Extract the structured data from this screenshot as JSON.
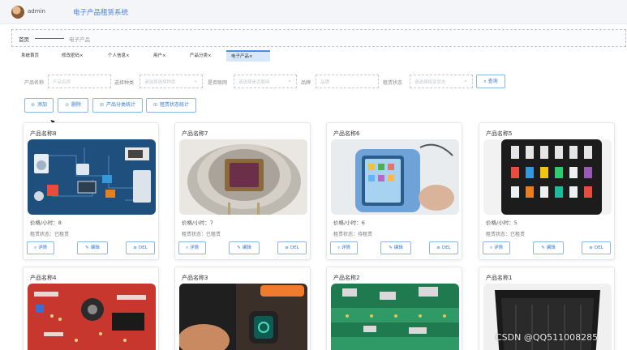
{
  "header": {
    "user": "admin",
    "system_title": "电子产品租赁系统",
    "avatar_icon": "user-avatar"
  },
  "breadcrumb": {
    "home": "首页",
    "current": "电子产品"
  },
  "tabs": [
    {
      "label": "系统首页"
    },
    {
      "label": "修改密码×"
    },
    {
      "label": "个人信息×"
    },
    {
      "label": "用户×"
    },
    {
      "label": "产品分类×"
    },
    {
      "label": "电子产品×",
      "active": true
    }
  ],
  "filters": {
    "name_label": "产品名称",
    "name_placeholder": "产品名称",
    "category_label": "选择种类",
    "category_placeholder": "请选择选择种类",
    "time_label": "是否联网",
    "time_placeholder": "请选择是否联网",
    "brand_label": "品牌",
    "brand_placeholder": "品牌",
    "status_label": "租赁状态",
    "status_placeholder": "请选择租赁状态",
    "search_label": "查询",
    "search_icon": "search-icon"
  },
  "actions": {
    "add": "添加",
    "delete": "删除",
    "category_stats": "产品分类统计",
    "rent_stats": "租赁状态统计"
  },
  "cards": [
    {
      "title": "产品名称8",
      "price": "价格/小时：8",
      "status": "租赁状态：已租赁",
      "image": "smart-home-illustration"
    },
    {
      "title": "产品名称7",
      "price": "价格/小时：7",
      "status": "租赁状态：已租赁",
      "image": "sensor-chip"
    },
    {
      "title": "产品名称6",
      "price": "价格/小时：6",
      "status": "租赁状态：待租赁",
      "image": "phone-pouch"
    },
    {
      "title": "产品名称5",
      "price": "价格/小时：5",
      "status": "租赁状态：已租赁",
      "image": "storage-case"
    },
    {
      "title": "产品名称4",
      "image": "red-circuit-board"
    },
    {
      "title": "产品名称3",
      "image": "smartwatch-charging"
    },
    {
      "title": "产品名称2",
      "image": "green-pcb"
    },
    {
      "title": "产品名称1",
      "image": "black-crate"
    }
  ],
  "card_buttons": {
    "detail": "详情",
    "edit": "编辑",
    "del": "DEL"
  },
  "watermark": "CSDN @QQ511008285",
  "colors": {
    "accent": "#3a78d0",
    "title_blue": "#4a7fd6",
    "tab_active_bg": "#d8e8fb"
  }
}
